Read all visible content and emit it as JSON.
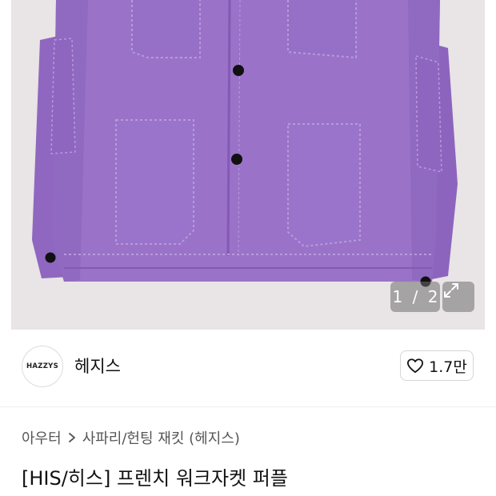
{
  "gallery": {
    "current_page": "1",
    "separator": "/",
    "total_pages": "2",
    "product_color": "#9a73c9"
  },
  "brand": {
    "logo_text": "HAZZYS",
    "name": "헤지스",
    "like_count": "1.7만"
  },
  "breadcrumb": {
    "category": "아우터",
    "subcategory": "사파리/헌팅 재킷 (헤지스)"
  },
  "product": {
    "title": "[HIS/히스] 프렌치 워크자켓 퍼플"
  }
}
